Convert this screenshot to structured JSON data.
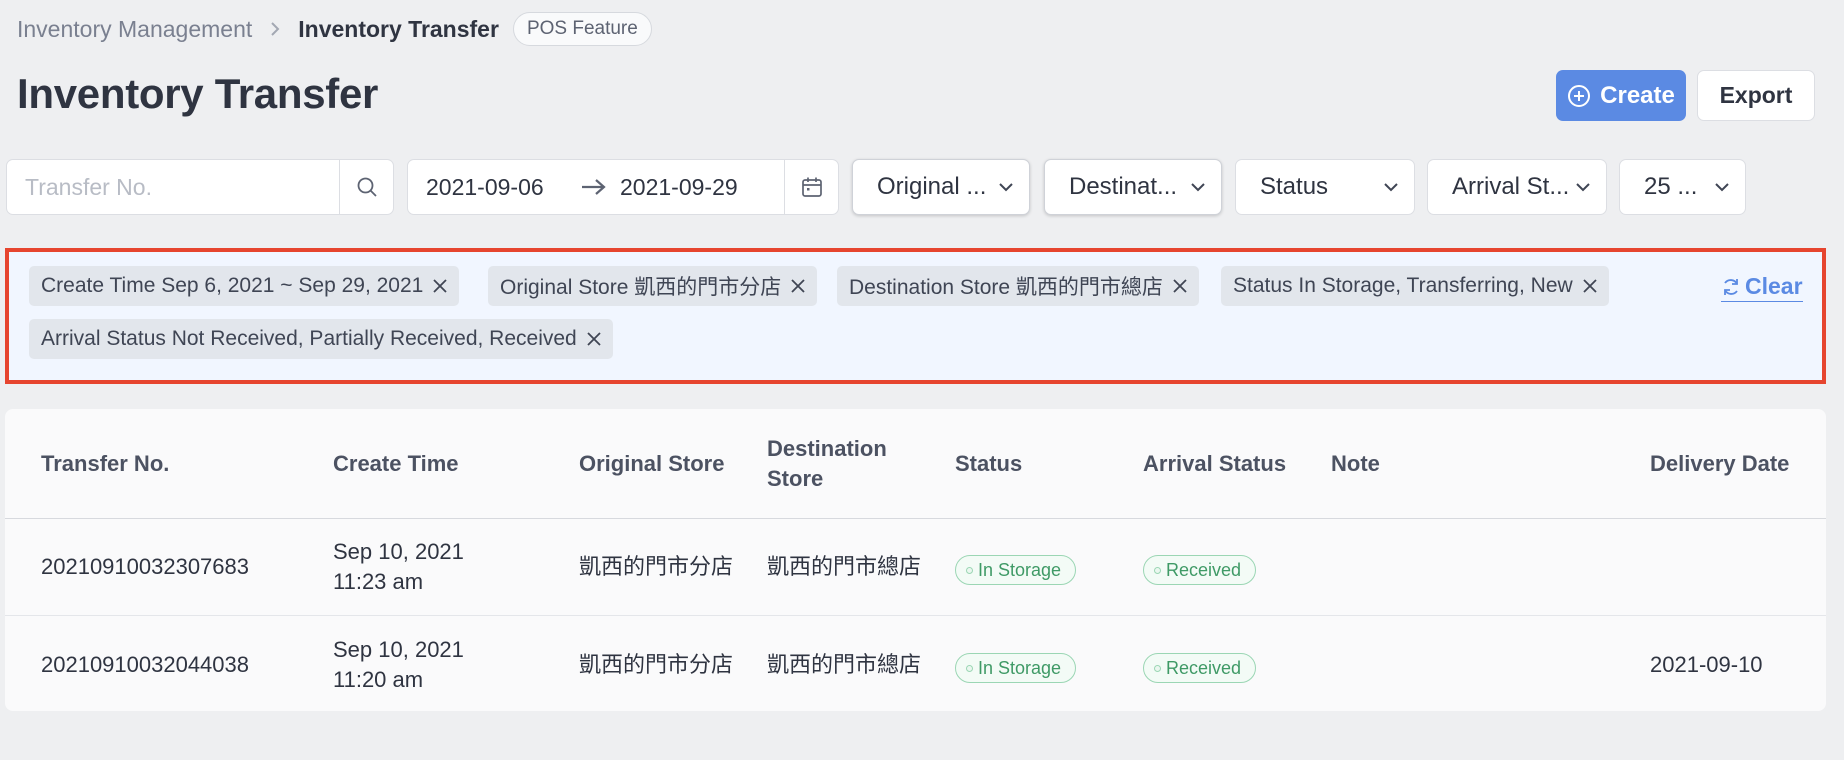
{
  "breadcrumb": {
    "parent": "Inventory Management",
    "current": "Inventory Transfer",
    "badge": "POS Feature"
  },
  "page": {
    "title": "Inventory Transfer",
    "create_label": "Create",
    "export_label": "Export"
  },
  "filters": {
    "search_placeholder": "Transfer No.",
    "date_start": "2021-09-06",
    "date_end": "2021-09-29",
    "original_store": "Original ...",
    "destination_store": "Destinat...",
    "status": "Status",
    "arrival_status": "Arrival St...",
    "page_size": "25 ..."
  },
  "active_tags": [
    "Create Time Sep 6, 2021 ~ Sep 29, 2021",
    "Original Store 凱西的門市分店",
    "Destination Store 凱西的門市總店",
    "Status In Storage, Transferring, New",
    "Arrival Status Not Received, Partially Received, Received"
  ],
  "clear_label": "Clear",
  "table": {
    "headers": {
      "transfer_no": "Transfer No.",
      "create_time": "Create Time",
      "original_store": "Original Store",
      "destination_store_1": "Destination",
      "destination_store_2": "Store",
      "status": "Status",
      "arrival_status": "Arrival Status",
      "note": "Note",
      "delivery_date": "Delivery Date"
    },
    "rows": [
      {
        "transfer_no": "20210910032307683",
        "create_date": "Sep 10, 2021",
        "create_time": "11:23 am",
        "original_store": "凱西的門市分店",
        "destination_store": "凱西的門市總店",
        "status": "In Storage",
        "arrival_status": "Received",
        "note": "",
        "delivery_date": ""
      },
      {
        "transfer_no": "20210910032044038",
        "create_date": "Sep 10, 2021",
        "create_time": "11:20 am",
        "original_store": "凱西的門市分店",
        "destination_store": "凱西的門市總店",
        "status": "In Storage",
        "arrival_status": "Received",
        "note": "",
        "delivery_date": "2021-09-10"
      }
    ]
  },
  "colors": {
    "primary": "#5b8ae3",
    "highlight_border": "#e6452f",
    "status_green": "#3f9a66"
  }
}
